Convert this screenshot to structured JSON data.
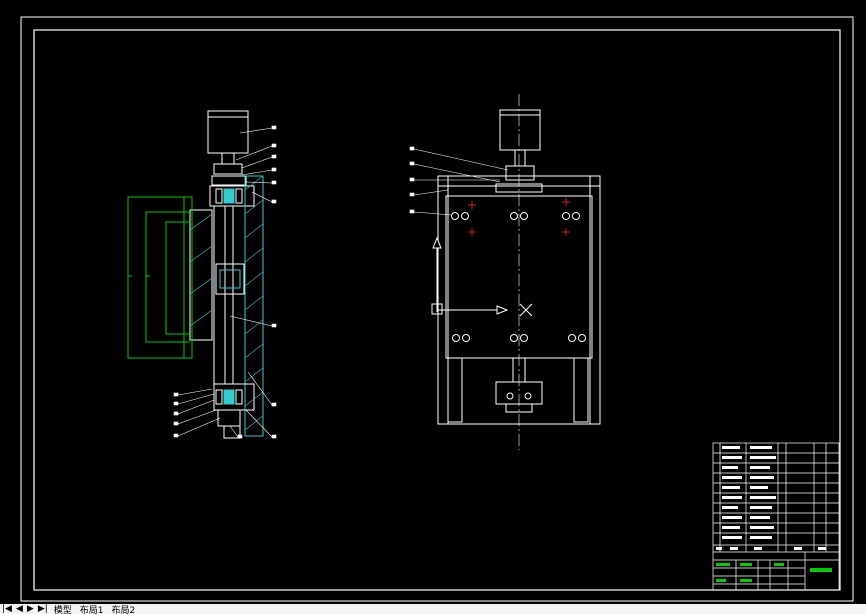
{
  "tabs": {
    "nav_first": "|◀",
    "nav_prev": "◀",
    "nav_next": "▶",
    "nav_last": "▶|",
    "model": "模型",
    "layout1": "布局1",
    "layout2": "布局2"
  },
  "colors": {
    "background": "#000000",
    "line": "#ffffff",
    "section": "#33cccc",
    "bracket": "#00c800",
    "leader": "#ffffff",
    "center_mark": "#ff2020",
    "title_green": "#00d000"
  }
}
